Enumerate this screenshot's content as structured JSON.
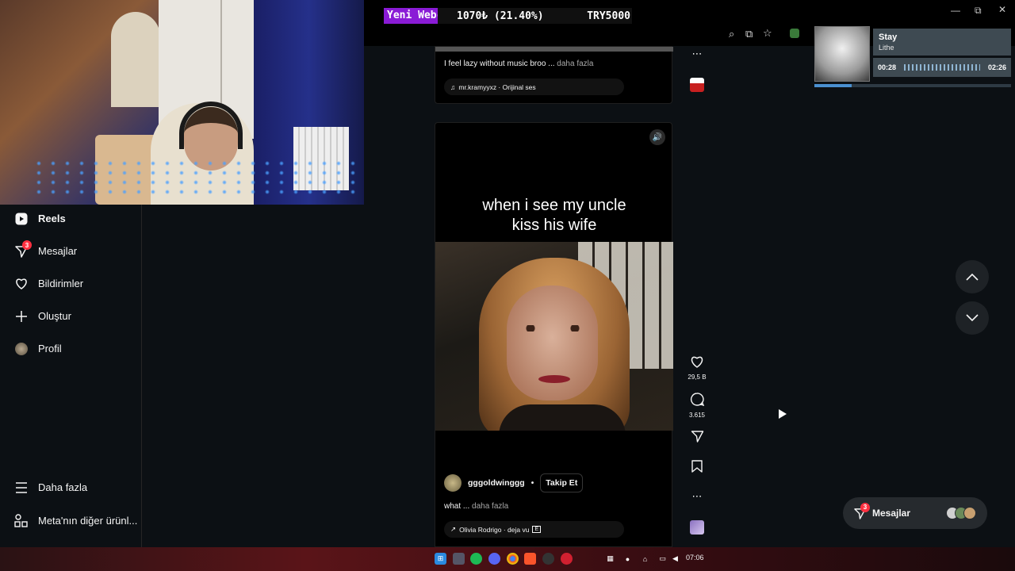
{
  "stream": {
    "ticker_name": "Yeni Webcam",
    "ticker_gold": "1070₺ (21.40%)",
    "ticker_goal": "TRY5000"
  },
  "sidebar": {
    "items": [
      {
        "label": "Reels",
        "icon": "reels-icon"
      },
      {
        "label": "Mesajlar",
        "icon": "messenger-icon",
        "badge": "3"
      },
      {
        "label": "Bildirimler",
        "icon": "heart-icon"
      },
      {
        "label": "Oluştur",
        "icon": "plus-icon"
      },
      {
        "label": "Profil",
        "icon": "avatar"
      },
      {
        "label": "Daha fazla",
        "icon": "menu-icon"
      },
      {
        "label": "Meta'nın diğer ürünl...",
        "icon": "meta-apps-icon"
      }
    ]
  },
  "prev_post": {
    "caption": "I feel lazy without music broo ...",
    "more": "daha fazla",
    "audio": "mr.kramyyxz · Orijinal ses"
  },
  "post": {
    "overlay_line1": "when i see my uncle",
    "overlay_line2": "kiss his wife",
    "username": "gggoldwinggg",
    "follow": "Takip Et",
    "caption": "what ...",
    "more": "daha fazla",
    "audio": "Olivia Rodrigo · deja vu",
    "explicit": "E",
    "likes": "29,5 B",
    "comments": "3.615"
  },
  "music": {
    "title": "Stay",
    "artist": "Lithe",
    "elapsed": "00:28",
    "total": "02:26",
    "progress": 0.19
  },
  "messages_pill": {
    "label": "Mesajlar",
    "badge": "3"
  },
  "taskbar": {
    "clock": "07:06"
  },
  "colors": {
    "accent_badge": "#ff3040",
    "ticker_purple": "#8a1bd6",
    "background": "#0c1014"
  }
}
